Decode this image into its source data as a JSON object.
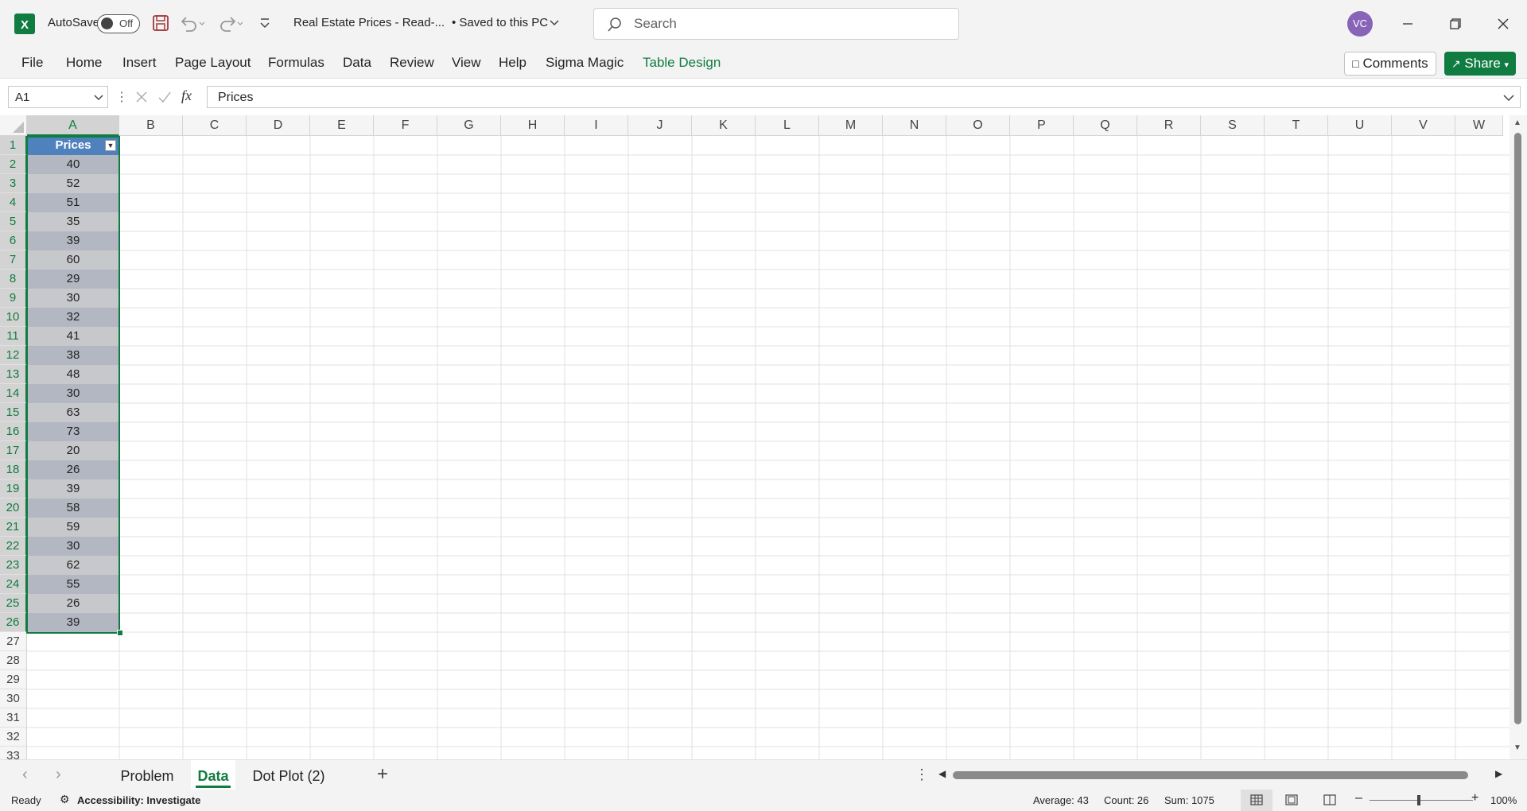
{
  "titlebar": {
    "autosave_label": "AutoSave",
    "autosave_state": "Off",
    "doc_title": "Real Estate Prices  -  Read-...",
    "save_status": "• Saved to this PC",
    "search_placeholder": "Search",
    "avatar_initials": "VC"
  },
  "ribbon": {
    "tabs": [
      "File",
      "Home",
      "Insert",
      "Page Layout",
      "Formulas",
      "Data",
      "Review",
      "View",
      "Help",
      "Sigma Magic",
      "Table Design"
    ],
    "comments_label": "Comments",
    "share_label": "Share"
  },
  "formula_bar": {
    "name_box": "A1",
    "fx_label": "fx",
    "content": "Prices"
  },
  "columns": [
    "A",
    "B",
    "C",
    "D",
    "E",
    "F",
    "G",
    "H",
    "I",
    "J",
    "K",
    "L",
    "M",
    "N",
    "O",
    "P",
    "Q",
    "R",
    "S",
    "T",
    "U",
    "V",
    "W"
  ],
  "rows": [
    "1",
    "2",
    "3",
    "4",
    "5",
    "6",
    "7",
    "8",
    "9",
    "10",
    "11",
    "12",
    "13",
    "14",
    "15",
    "16",
    "17",
    "18",
    "19",
    "20",
    "21",
    "22",
    "23",
    "24",
    "25",
    "26",
    "27",
    "28",
    "29",
    "30",
    "31",
    "32",
    "33"
  ],
  "table": {
    "header": "Prices",
    "values": [
      "40",
      "52",
      "51",
      "35",
      "39",
      "60",
      "29",
      "30",
      "32",
      "41",
      "38",
      "48",
      "30",
      "63",
      "73",
      "20",
      "26",
      "39",
      "58",
      "59",
      "30",
      "62",
      "55",
      "26",
      "39"
    ]
  },
  "sheets": {
    "tabs": [
      "Problem",
      "Data",
      "Dot Plot (2)"
    ],
    "active": "Data"
  },
  "status": {
    "ready": "Ready",
    "accessibility": "Accessibility: Investigate",
    "average": "Average: 43",
    "count": "Count: 26",
    "sum": "Sum: 1075",
    "zoom": "100%"
  },
  "colors": {
    "excel_green": "#107c41",
    "table_header_blue": "#4f81bd",
    "avatar_purple": "#8764b8"
  }
}
